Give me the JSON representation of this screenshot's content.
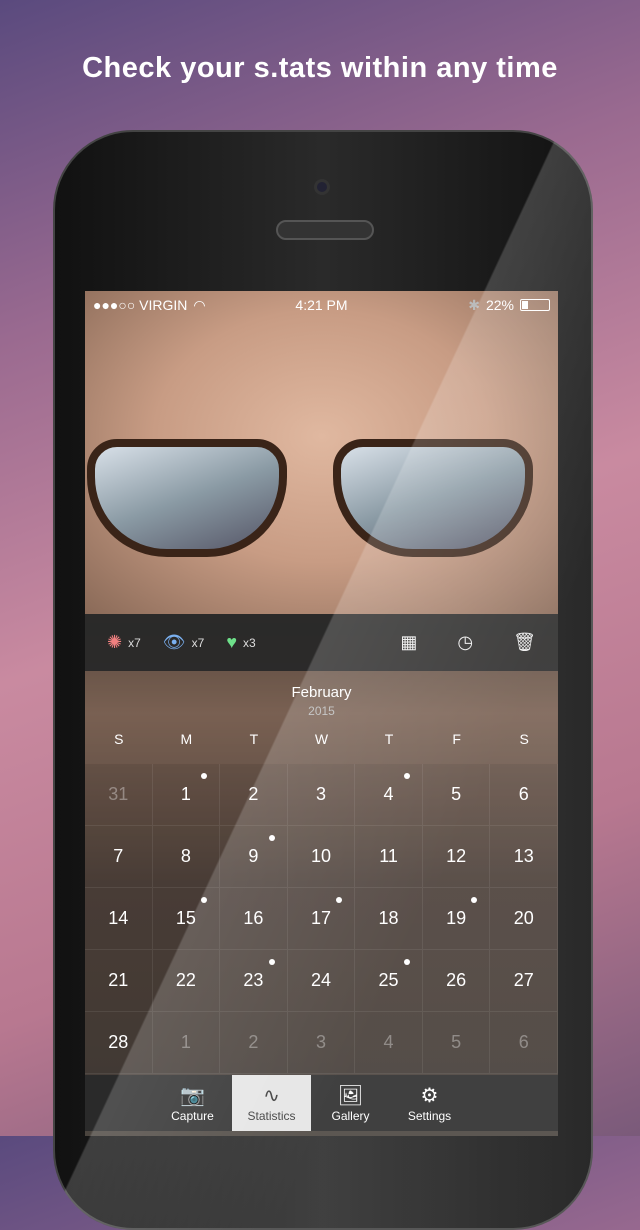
{
  "headline": "Check your s.tats within any time",
  "status": {
    "carrier": "●●●○○ VIRGIN",
    "time": "4:21 PM",
    "battery": "22%",
    "battery_level": 0.22
  },
  "stats": [
    {
      "icon": "network-icon",
      "count": "x7",
      "color": "#f08080"
    },
    {
      "icon": "eye-icon",
      "count": "x7",
      "color": "#7ab0f0"
    },
    {
      "icon": "heartbeat-icon",
      "count": "x3",
      "color": "#6ee08a"
    }
  ],
  "toolbar": {
    "calendar": "calendar-icon",
    "clock": "clock-lock-icon",
    "delete": "trash-icon"
  },
  "calendar": {
    "month": "February",
    "year": "2015",
    "weekdays": [
      "S",
      "M",
      "T",
      "W",
      "T",
      "F",
      "S"
    ],
    "days": [
      {
        "d": "31",
        "muted": true
      },
      {
        "d": "1",
        "dot": true
      },
      {
        "d": "2"
      },
      {
        "d": "3"
      },
      {
        "d": "4",
        "dot": true
      },
      {
        "d": "5"
      },
      {
        "d": "6"
      },
      {
        "d": "7"
      },
      {
        "d": "8"
      },
      {
        "d": "9",
        "dot": true
      },
      {
        "d": "10"
      },
      {
        "d": "11"
      },
      {
        "d": "12"
      },
      {
        "d": "13"
      },
      {
        "d": "14"
      },
      {
        "d": "15",
        "dot": true
      },
      {
        "d": "16"
      },
      {
        "d": "17",
        "dot": true
      },
      {
        "d": "18"
      },
      {
        "d": "19",
        "dot": true
      },
      {
        "d": "20"
      },
      {
        "d": "21"
      },
      {
        "d": "22"
      },
      {
        "d": "23",
        "dot": true
      },
      {
        "d": "24"
      },
      {
        "d": "25",
        "dot": true
      },
      {
        "d": "26"
      },
      {
        "d": "27"
      },
      {
        "d": "28"
      },
      {
        "d": "1",
        "muted": true
      },
      {
        "d": "2",
        "muted": true
      },
      {
        "d": "3",
        "muted": true
      },
      {
        "d": "4",
        "muted": true
      },
      {
        "d": "5",
        "muted": true
      },
      {
        "d": "6",
        "muted": true
      }
    ]
  },
  "tabs": [
    {
      "label": "Capture",
      "icon": "camera-icon"
    },
    {
      "label": "Statistics",
      "icon": "chart-line-icon",
      "active": true
    },
    {
      "label": "Gallery",
      "icon": "image-icon"
    },
    {
      "label": "Settings",
      "icon": "gears-icon"
    }
  ]
}
